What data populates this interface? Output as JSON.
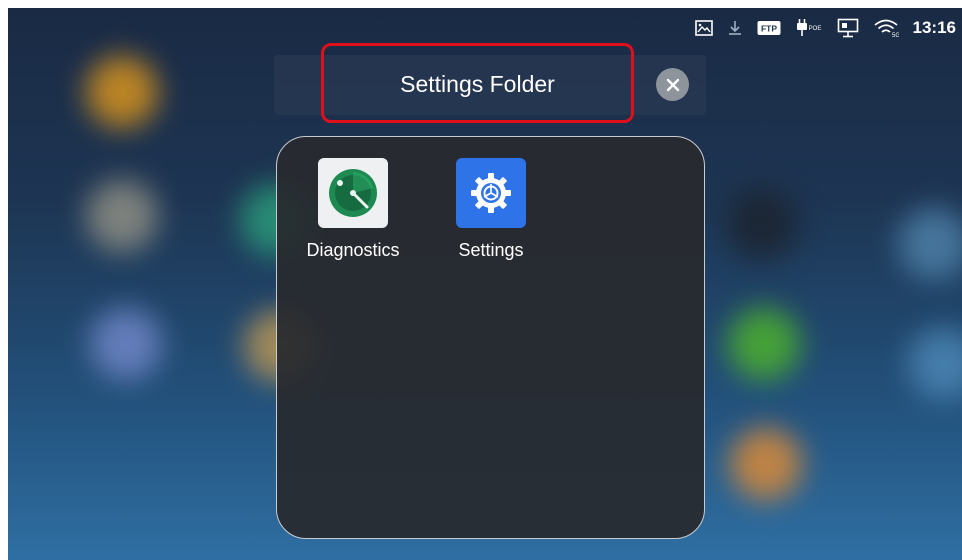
{
  "status_bar": {
    "time": "13:16",
    "icons": [
      "screenshot-icon",
      "download-icon",
      "ftp-icon",
      "poe-icon",
      "network-icon",
      "wifi-5g-icon"
    ],
    "ftp_label": "FTP",
    "poe_label": "POE",
    "wifi_label": "5G"
  },
  "folder": {
    "title": "Settings Folder",
    "close_icon": "close-icon",
    "apps": [
      {
        "label": "Diagnostics",
        "icon": "diagnostics-icon"
      },
      {
        "label": "Settings",
        "icon": "settings-gear-icon"
      }
    ]
  },
  "colors": {
    "highlight_border": "#e0101a",
    "settings_icon_bg": "#2f73e8",
    "diagnostics_icon_bg": "#eef0f2",
    "diagnostics_accent": "#1e8a52"
  }
}
